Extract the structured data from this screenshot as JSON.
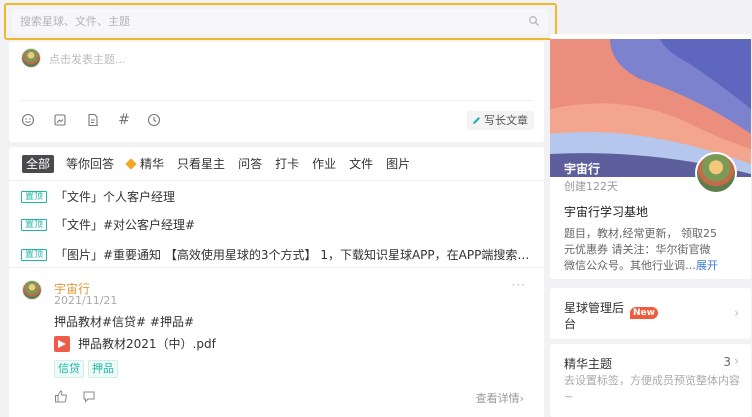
{
  "search": {
    "placeholder": "搜索星球、文件、主题"
  },
  "composer": {
    "placeholder": "点击发表主题...",
    "tools": [
      "emoji-icon",
      "image-icon",
      "file-icon",
      "hashtag-icon",
      "clock-icon"
    ],
    "write_long_label": "写长文章"
  },
  "filters": [
    {
      "label": "全部",
      "active": true
    },
    {
      "label": "等你回答"
    },
    {
      "label": "精华",
      "icon": "gem-icon"
    },
    {
      "label": "只看星主"
    },
    {
      "label": "问答"
    },
    {
      "label": "打卡"
    },
    {
      "label": "作业"
    },
    {
      "label": "文件"
    },
    {
      "label": "图片"
    }
  ],
  "pinned": [
    {
      "badge": "置顶",
      "text": "「文件」个人客户经理"
    },
    {
      "badge": "置顶",
      "text": "「文件」#对公客户经理#"
    },
    {
      "badge": "置顶",
      "text": "「图片」#重要通知 【高效使用星球的3个方式】 1，下载知识星球APP，在APP端搜索关..."
    }
  ],
  "post": {
    "author": "宇宙行",
    "date": "2021/11/21",
    "more": "···",
    "body": "押品教材#信贷# #押品#",
    "file_name": "押品教材2021（中）.pdf",
    "tags": [
      "信贷",
      "押品"
    ],
    "detail_link": "查看详情›"
  },
  "group": {
    "name": "宇宙行",
    "created": "创建122天",
    "title": "宇宙行学习基地",
    "desc_lines": [
      "题目，教材,经常更新， 领取25",
      "元优惠券 请关注：华尔街官微",
      "微信公众号。其他行业调…"
    ],
    "expand": "展开"
  },
  "management": {
    "title": "星球管理后台",
    "badge": "New"
  },
  "essence": {
    "title": "精华主题",
    "count": "3",
    "desc": "去设置标签，方便成员预览整体内容~"
  },
  "colors": {
    "accent": "#1fb5a8",
    "author": "#e39a3b",
    "highlight": "#f0b92d",
    "new_badge": "#f15a3b"
  }
}
